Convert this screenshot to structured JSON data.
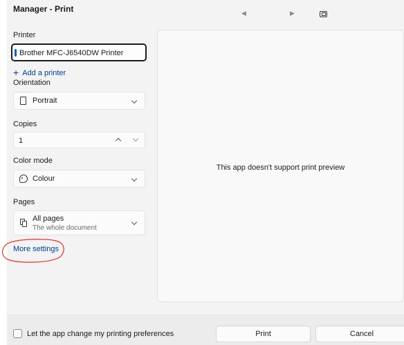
{
  "window": {
    "title": "Manager - Print"
  },
  "printer": {
    "label": "Printer",
    "value": "Brother MFC-J6540DW Printer",
    "add_label": "Add a printer"
  },
  "orientation": {
    "label": "Orientation",
    "value": "Portrait"
  },
  "copies": {
    "label": "Copies",
    "value": "1"
  },
  "color_mode": {
    "label": "Color mode",
    "value": "Colour"
  },
  "pages": {
    "label": "Pages",
    "value": "All pages",
    "description": "The whole document"
  },
  "more_settings": "More settings",
  "preview": {
    "message": "This app doesn't support print preview"
  },
  "footer": {
    "checkbox_label": "Let the app change my printing preferences",
    "print_button": "Print",
    "cancel_button": "Cancel"
  },
  "annotation_color": "#e03030"
}
